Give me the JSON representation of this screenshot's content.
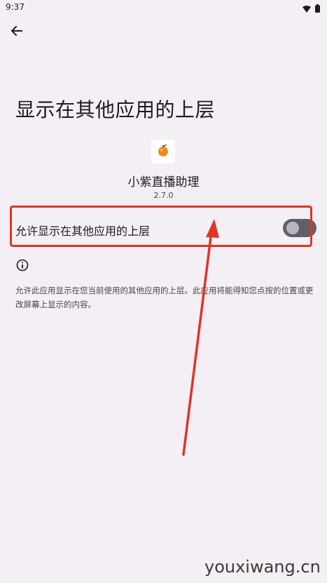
{
  "status_bar": {
    "time": "9:37",
    "wifi_icon": "wifi-icon",
    "battery_icon": "battery-icon"
  },
  "header": {
    "back_icon": "arrow-left-icon"
  },
  "page": {
    "title": "显示在其他应用的上层"
  },
  "app": {
    "icon": "orange-icon",
    "name": "小紫直播助理",
    "version": "2.7.0"
  },
  "setting": {
    "label": "允许显示在其他应用的上层",
    "enabled": false
  },
  "info": {
    "icon": "info-icon",
    "description": "允许此应用显示在您当前使用的其他应用的上层。此应用将能得知您点按的位置或更改屏幕上显示的内容。"
  },
  "watermark": "youxiwang.cn",
  "colors": {
    "background": "#f4eff4",
    "annotation_red": "#e03428",
    "switch_track_off": "#606068",
    "switch_thumb_off": "#bab6c0"
  }
}
